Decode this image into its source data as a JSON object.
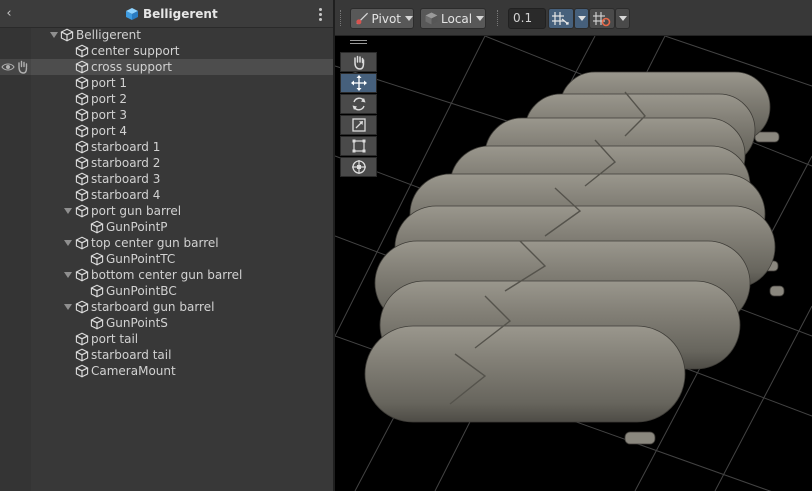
{
  "hierarchy": {
    "title": "Belligerent",
    "back_icon": "chevron-left-icon",
    "menu_icon": "kebab-menu-icon",
    "items": [
      {
        "label": "Belligerent",
        "level": 0,
        "foldout": true,
        "selected": false
      },
      {
        "label": "center support",
        "level": 1,
        "foldout": false,
        "selected": false
      },
      {
        "label": "cross support",
        "level": 1,
        "foldout": false,
        "selected": true
      },
      {
        "label": "port 1",
        "level": 1,
        "foldout": false,
        "selected": false
      },
      {
        "label": "port 2",
        "level": 1,
        "foldout": false,
        "selected": false
      },
      {
        "label": "port 3",
        "level": 1,
        "foldout": false,
        "selected": false
      },
      {
        "label": "port 4",
        "level": 1,
        "foldout": false,
        "selected": false
      },
      {
        "label": "starboard 1",
        "level": 1,
        "foldout": false,
        "selected": false
      },
      {
        "label": "starboard 2",
        "level": 1,
        "foldout": false,
        "selected": false
      },
      {
        "label": "starboard 3",
        "level": 1,
        "foldout": false,
        "selected": false
      },
      {
        "label": "starboard 4",
        "level": 1,
        "foldout": false,
        "selected": false
      },
      {
        "label": "port gun barrel",
        "level": 1,
        "foldout": true,
        "selected": false
      },
      {
        "label": "GunPointP",
        "level": 2,
        "foldout": false,
        "selected": false
      },
      {
        "label": "top center gun barrel",
        "level": 1,
        "foldout": true,
        "selected": false
      },
      {
        "label": "GunPointTC",
        "level": 2,
        "foldout": false,
        "selected": false
      },
      {
        "label": "bottom center gun barrel",
        "level": 1,
        "foldout": true,
        "selected": false
      },
      {
        "label": "GunPointBC",
        "level": 2,
        "foldout": false,
        "selected": false
      },
      {
        "label": "starboard gun barrel",
        "level": 1,
        "foldout": true,
        "selected": false
      },
      {
        "label": "GunPointS",
        "level": 2,
        "foldout": false,
        "selected": false
      },
      {
        "label": "port tail",
        "level": 1,
        "foldout": false,
        "selected": false
      },
      {
        "label": "starboard tail",
        "level": 1,
        "foldout": false,
        "selected": false
      },
      {
        "label": "CameraMount",
        "level": 1,
        "foldout": false,
        "selected": false
      }
    ]
  },
  "scene_toolbar": {
    "pivot_label": "Pivot",
    "space_label": "Local",
    "snap_value": "0.1",
    "grid_snap_icon": "grid-snap-icon",
    "increment_snap_icon": "increment-snap-icon"
  },
  "tools": [
    {
      "name": "hand",
      "icon": "hand-icon",
      "active": false
    },
    {
      "name": "move",
      "icon": "move-icon",
      "active": true
    },
    {
      "name": "rotate",
      "icon": "rotate-icon",
      "active": false
    },
    {
      "name": "scale",
      "icon": "scale-icon",
      "active": false
    },
    {
      "name": "rect",
      "icon": "rect-transform-icon",
      "active": false
    },
    {
      "name": "transform",
      "icon": "transform-icon",
      "active": false
    }
  ],
  "colors": {
    "panel_bg": "#383838",
    "selected_row": "#4d4d4d",
    "accent_blue": "#46607c",
    "text": "#d2d2d2",
    "hull": "#77746b"
  }
}
